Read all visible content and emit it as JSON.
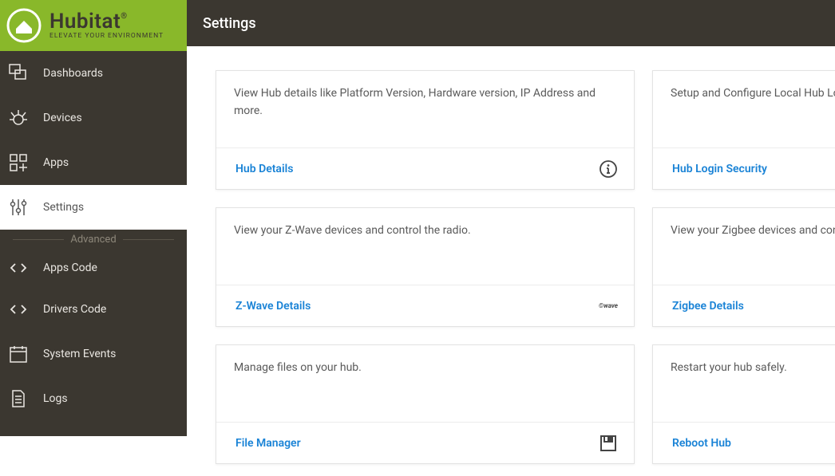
{
  "logo": {
    "brand": "Hubitat",
    "tagline": "ELEVATE YOUR ENVIRONMENT"
  },
  "header": {
    "title": "Settings"
  },
  "sidebar": {
    "items": [
      {
        "label": "Dashboards"
      },
      {
        "label": "Devices"
      },
      {
        "label": "Apps"
      },
      {
        "label": "Settings"
      }
    ],
    "advanced_label": "Advanced",
    "advanced_items": [
      {
        "label": "Apps Code"
      },
      {
        "label": "Drivers Code"
      },
      {
        "label": "System Events"
      },
      {
        "label": "Logs"
      }
    ]
  },
  "cards": [
    {
      "desc": "View Hub details like Platform Version, Hardware version, IP Address and more.",
      "link": "Hub Details",
      "icon": "info"
    },
    {
      "desc": "Setup and Configure Local Hub Lo",
      "link": "Hub Login Security",
      "icon": ""
    },
    {
      "desc": "View your Z-Wave devices and control the radio.",
      "link": "Z-Wave Details",
      "icon": "zwave"
    },
    {
      "desc": "View your Zigbee devices and con",
      "link": "Zigbee Details",
      "icon": ""
    },
    {
      "desc": "Manage files on your hub.",
      "link": "File Manager",
      "icon": "save"
    },
    {
      "desc": "Restart your hub safely.",
      "link": "Reboot Hub",
      "icon": ""
    }
  ]
}
